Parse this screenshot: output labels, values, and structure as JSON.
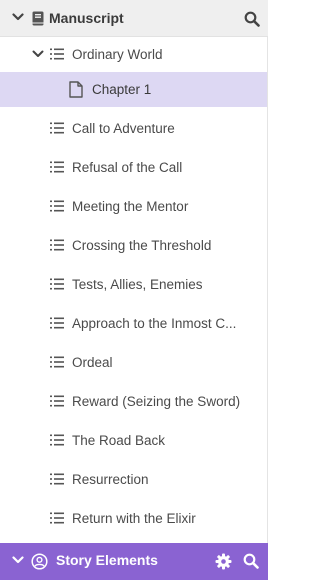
{
  "header": {
    "title": "Manuscript"
  },
  "tree": {
    "parent": "Ordinary World",
    "selected_child": "Chapter 1",
    "items": [
      "Call to Adventure",
      "Refusal of the Call",
      "Meeting the Mentor",
      "Crossing the Threshold",
      "Tests, Allies, Enemies",
      "Approach to the Inmost C...",
      "Ordeal",
      "Reward (Seizing the Sword)",
      "The Road Back",
      "Resurrection",
      "Return with the Elixir"
    ]
  },
  "footer": {
    "title": "Story Elements"
  },
  "colors": {
    "accent": "#8a63d2",
    "selected": "#ddd8f3",
    "header_bg": "#efefef"
  },
  "icons": {
    "header": [
      "chevron-down-icon",
      "book-icon",
      "search-icon"
    ],
    "row": [
      "list-icon",
      "document-icon"
    ],
    "footer": [
      "chevron-down-icon",
      "person-icon",
      "gear-icon",
      "search-icon"
    ]
  }
}
